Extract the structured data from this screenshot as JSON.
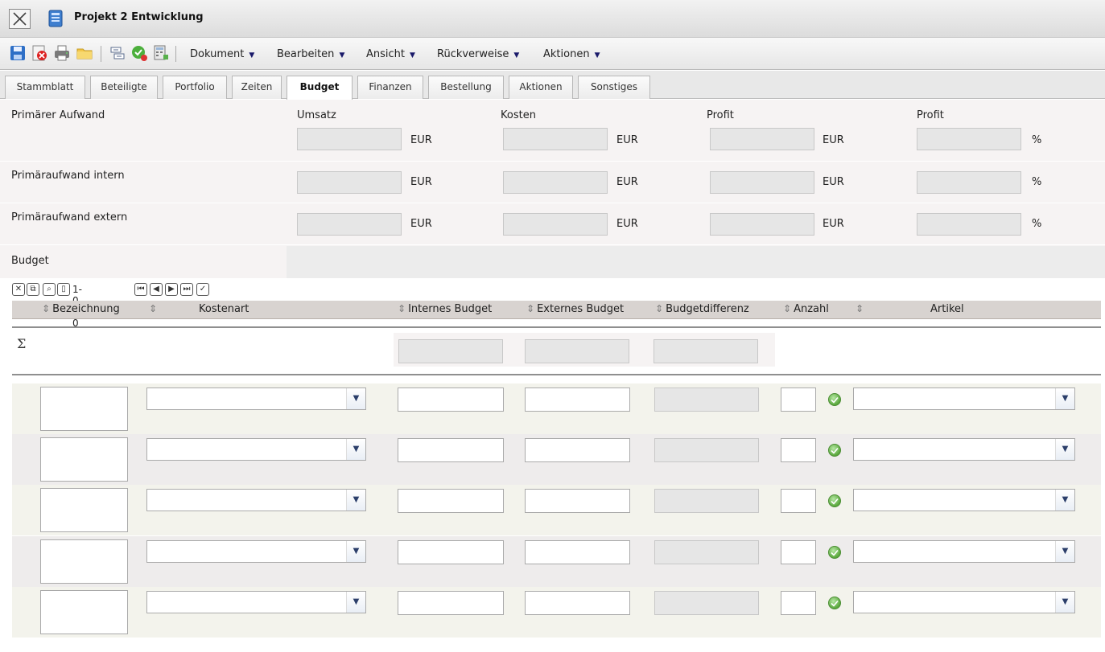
{
  "window": {
    "title": "Projekt 2 Entwicklung"
  },
  "toolbar": {
    "icons": [
      "save-icon",
      "delete-icon",
      "print-icon",
      "folder-icon",
      "copy-icon",
      "check-icon",
      "calculator-icon"
    ],
    "menus": [
      {
        "label": "Dokument"
      },
      {
        "label": "Bearbeiten"
      },
      {
        "label": "Ansicht"
      },
      {
        "label": "Rückverweise"
      },
      {
        "label": "Aktionen"
      }
    ]
  },
  "tabs": [
    {
      "label": "Stammblatt"
    },
    {
      "label": "Beteiligte"
    },
    {
      "label": "Portfolio"
    },
    {
      "label": "Zeiten"
    },
    {
      "label": "Budget",
      "active": true
    },
    {
      "label": "Finanzen"
    },
    {
      "label": "Bestellung"
    },
    {
      "label": "Aktionen"
    },
    {
      "label": "Sonstiges"
    }
  ],
  "summary": {
    "columns": [
      "Umsatz",
      "Kosten",
      "Profit",
      "Profit"
    ],
    "units": [
      "EUR",
      "EUR",
      "EUR",
      "%"
    ],
    "rows": [
      {
        "label": "Primärer Aufwand"
      },
      {
        "label": "Primäraufwand intern"
      },
      {
        "label": "Primäraufwand extern"
      }
    ],
    "budget_label": "Budget"
  },
  "grid": {
    "record_count": "1-0 / 0",
    "columns": [
      "Bezeichnung",
      "Kostenart",
      "Internes Budget",
      "Externes Budget",
      "Budgetdifferenz",
      "Anzahl",
      "Artikel"
    ],
    "sum_symbol": "Σ",
    "row_count": 5
  }
}
